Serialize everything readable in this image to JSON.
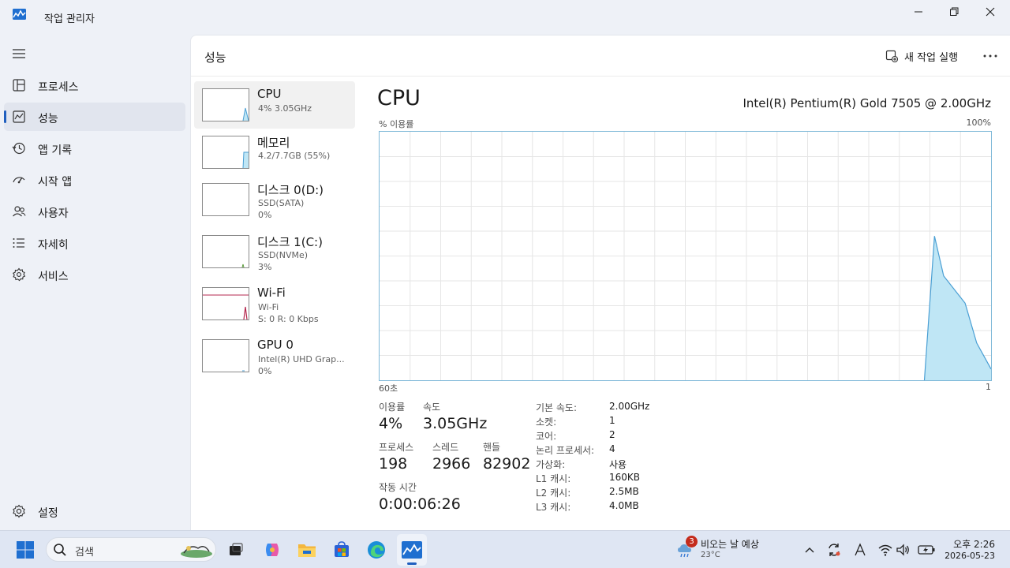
{
  "window": {
    "title": "작업 관리자"
  },
  "sidebar": {
    "items": [
      {
        "label": "프로세스",
        "icon": "grid-icon"
      },
      {
        "label": "성능",
        "icon": "performance-icon",
        "active": true
      },
      {
        "label": "앱 기록",
        "icon": "history-icon"
      },
      {
        "label": "시작 앱",
        "icon": "startup-icon"
      },
      {
        "label": "사용자",
        "icon": "users-icon"
      },
      {
        "label": "자세히",
        "icon": "details-icon"
      },
      {
        "label": "서비스",
        "icon": "services-icon"
      }
    ],
    "settings_label": "설정"
  },
  "header": {
    "title": "성능",
    "new_task_label": "새 작업 실행"
  },
  "devices": [
    {
      "name": "CPU",
      "line1": "4% 3.05GHz",
      "line2": ""
    },
    {
      "name": "메모리",
      "line1": "4.2/7.7GB (55%)",
      "line2": ""
    },
    {
      "name": "디스크 0(D:)",
      "line1": "SSD(SATA)",
      "line2": "0%"
    },
    {
      "name": "디스크 1(C:)",
      "line1": "SSD(NVMe)",
      "line2": "3%"
    },
    {
      "name": "Wi-Fi",
      "line1": "Wi-Fi",
      "line2": "S: 0 R: 0 Kbps"
    },
    {
      "name": "GPU 0",
      "line1": "Intel(R) UHD Grap...",
      "line2": "0%"
    }
  ],
  "cpu": {
    "title": "CPU",
    "model": "Intel(R) Pentium(R) Gold 7505 @ 2.00GHz",
    "axis_top_left": "% 이용률",
    "axis_top_right": "100%",
    "axis_bottom_left": "60초",
    "axis_bottom_right": "1",
    "stats": {
      "usage_label": "이용률",
      "usage_value": "4%",
      "speed_label": "속도",
      "speed_value": "3.05GHz",
      "process_label": "프로세스",
      "process_value": "198",
      "thread_label": "스레드",
      "thread_value": "2966",
      "handle_label": "핸들",
      "handle_value": "82902",
      "uptime_label": "작동 시간",
      "uptime_value": "0:00:06:26"
    },
    "specs": [
      {
        "label": "기본 속도:",
        "value": "2.00GHz"
      },
      {
        "label": "소켓:",
        "value": "1"
      },
      {
        "label": "코어:",
        "value": "2"
      },
      {
        "label": "논리 프로세서:",
        "value": "4"
      },
      {
        "label": "가상화:",
        "value": "사용"
      },
      {
        "label": "L1 캐시:",
        "value": "160KB"
      },
      {
        "label": "L2 캐시:",
        "value": "2.5MB"
      },
      {
        "label": "L3 캐시:",
        "value": "4.0MB"
      }
    ],
    "graph_color": "#4a9fd4",
    "graph_fill": "#bfe6f5"
  },
  "taskbar": {
    "search_placeholder": "검색",
    "weather_label": "비오는 날 예상",
    "weather_temp": "23°C",
    "weather_badge": "3",
    "time": "오후 2:26",
    "date": "2026-05-23"
  }
}
